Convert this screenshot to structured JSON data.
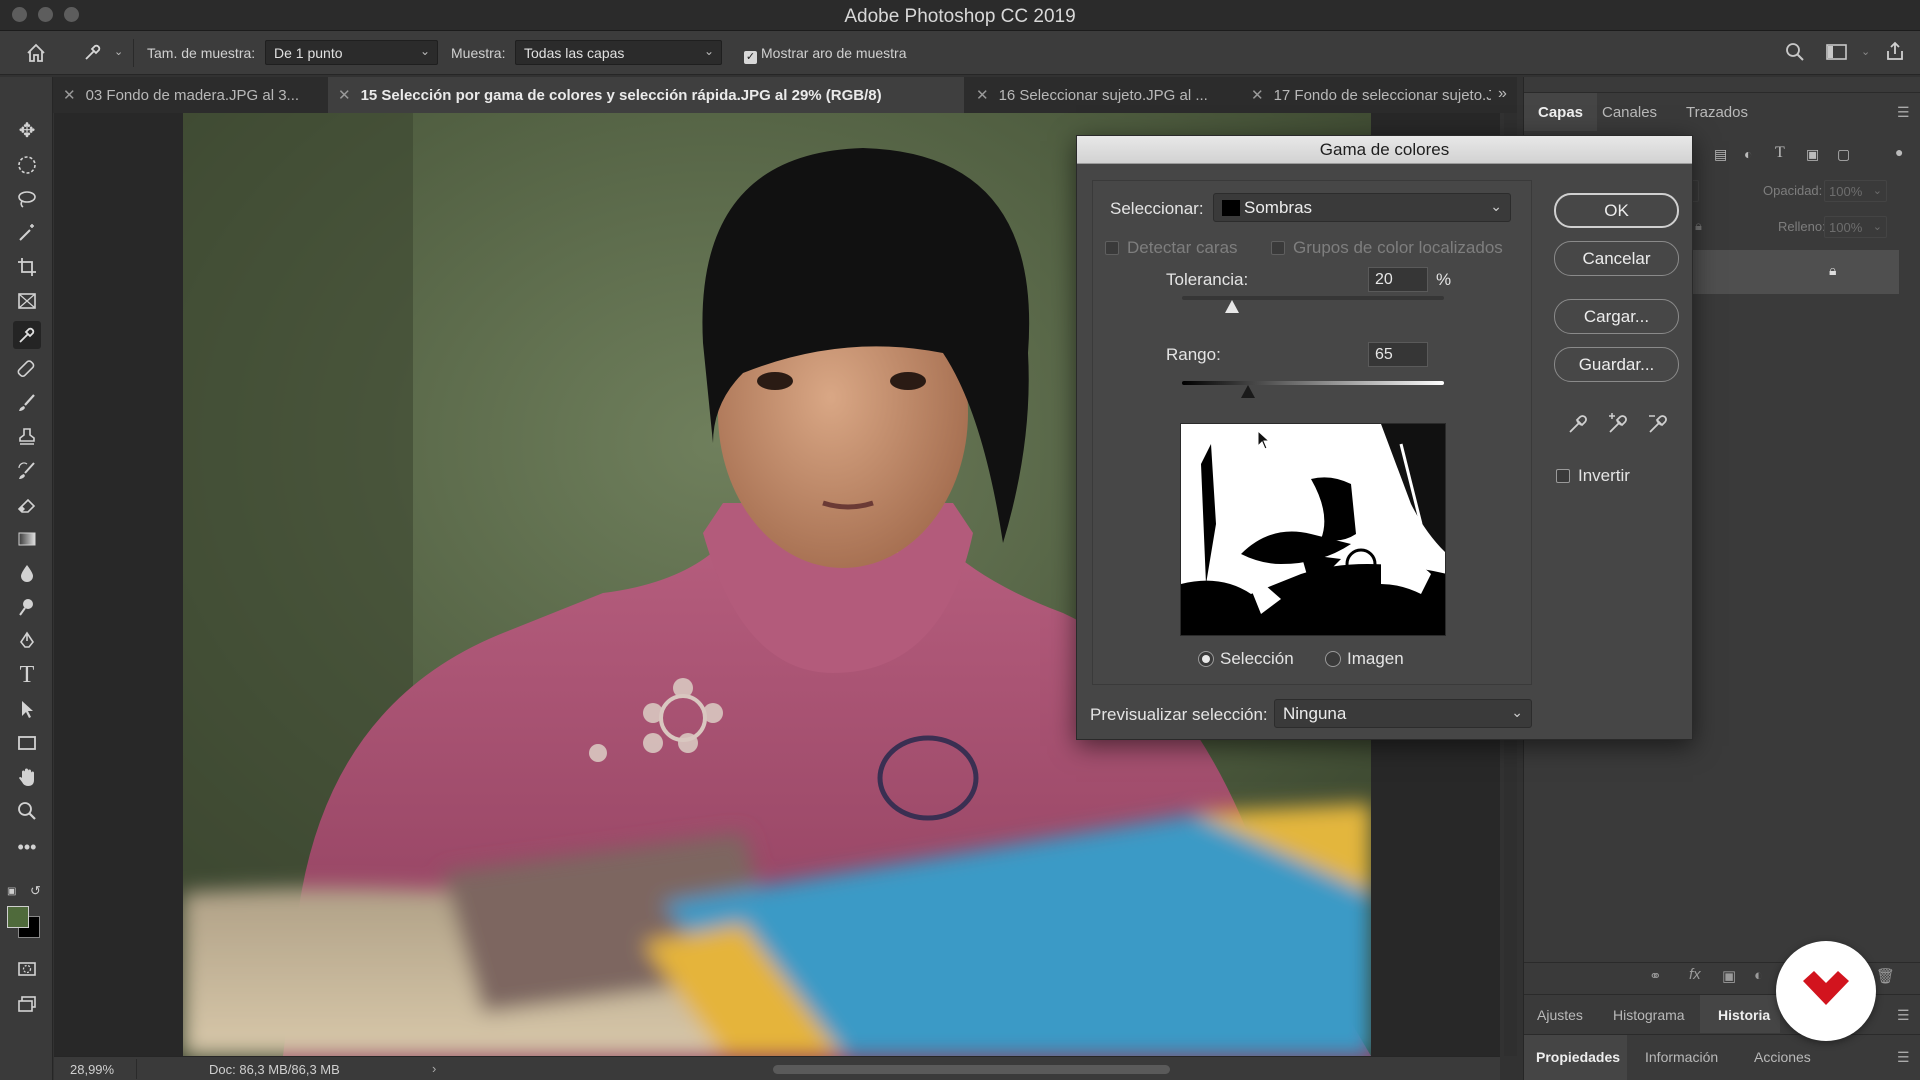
{
  "window": {
    "title": "Adobe Photoshop CC 2019"
  },
  "options_bar": {
    "tool_icon": "eyedropper-icon",
    "sample_size_label": "Tam. de muestra:",
    "sample_size_value": "De 1 punto",
    "sample_label": "Muestra:",
    "sample_value": "Todas las capas",
    "show_ring_label": "Mostrar aro de muestra",
    "show_ring_checked": true
  },
  "tabs": [
    {
      "label": "03 Fondo de madera.JPG al 3...",
      "active": false
    },
    {
      "label": "15 Selección por gama de colores y selección rápida.JPG al 29% (RGB/8)",
      "active": true
    },
    {
      "label": "16 Seleccionar sujeto.JPG al ...",
      "active": false
    },
    {
      "label": "17 Fondo de seleccionar sujeto.J",
      "active": false
    }
  ],
  "status_bar": {
    "zoom": "28,99%",
    "doc": "Doc: 86,3 MB/86,3 MB"
  },
  "right_panel": {
    "top_tabs": [
      "Capas",
      "Canales",
      "Trazados"
    ],
    "opacity_label": "Opacidad:",
    "opacity_value": "100%",
    "fill_label": "Relleno:",
    "fill_value": "100%",
    "mid_tabs": [
      "Ajustes",
      "Histograma",
      "Historia"
    ],
    "bottom_tabs": [
      "Propiedades",
      "Información",
      "Acciones"
    ]
  },
  "dialog": {
    "title": "Gama de colores",
    "select_label": "Seleccionar:",
    "select_value": "Sombras",
    "detect_faces_label": "Detectar caras",
    "localized_groups_label": "Grupos de color localizados",
    "tolerance_label": "Tolerancia:",
    "tolerance_value": "20",
    "tolerance_unit": "%",
    "tolerance_fraction": 0.19,
    "range_label": "Rango:",
    "range_value": "65",
    "range_fraction": 0.25,
    "view_selection_label": "Selección",
    "view_image_label": "Imagen",
    "view_selected": "Selección",
    "preview_label": "Previsualizar selección:",
    "preview_value": "Ninguna",
    "buttons": {
      "ok": "OK",
      "cancel": "Cancelar",
      "load": "Cargar...",
      "save": "Guardar..."
    },
    "invert_label": "Invertir",
    "invert_checked": false
  },
  "colors": {
    "foreground": "#4f6a3b",
    "background": "#000000",
    "badge_accent": "#d2141e"
  }
}
